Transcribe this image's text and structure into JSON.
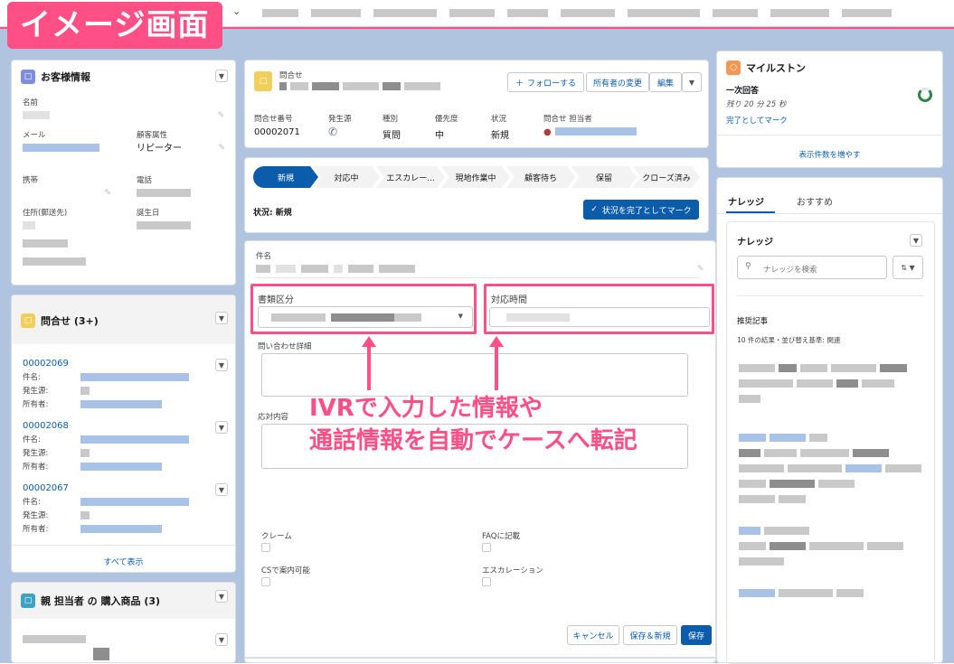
{
  "badge": "イメージ画面",
  "customer": {
    "title": "お客様情報",
    "fields": {
      "name": "名前",
      "email": "メール",
      "attribute": "顧客属性",
      "attribute_value": "リピーター",
      "mobile": "携帯",
      "phone": "電話",
      "address": "住所(郵送先)",
      "birthday": "誕生日"
    }
  },
  "inquiries": {
    "title": "問合せ (3+)",
    "items": [
      {
        "number": "00002069",
        "l1": "件名:",
        "l2": "発生源:",
        "l3": "所有者:"
      },
      {
        "number": "00002068",
        "l1": "件名:",
        "l2": "発生源:",
        "l3": "所有者:"
      },
      {
        "number": "00002067",
        "l1": "件名:",
        "l2": "発生源:",
        "l3": "所有者:"
      }
    ],
    "view_all": "すべて表示"
  },
  "purchases": {
    "title": "親 担当者 の 購入商品 (3)"
  },
  "case_header": {
    "object_label": "問合せ",
    "follow": "フォローする",
    "change_owner": "所有者の変更",
    "edit": "編集",
    "fields": [
      {
        "label": "問合せ番号",
        "value": "00002071"
      },
      {
        "label": "発生源",
        "value": ""
      },
      {
        "label": "種別",
        "value": "質問"
      },
      {
        "label": "優先度",
        "value": "中"
      },
      {
        "label": "状況",
        "value": "新規"
      },
      {
        "label": "問合せ 担当者",
        "value": ""
      }
    ]
  },
  "path": {
    "steps": [
      "新規",
      "対応中",
      "エスカレー...",
      "現地作業中",
      "顧客待ち",
      "保留",
      "クローズ済み"
    ],
    "status_text": "状況: 新規",
    "complete_button": "状況を完了としてマーク"
  },
  "form": {
    "subject_label": "件名",
    "category_label": "書類区分",
    "time_label": "対応時間",
    "detail_label": "問い合わせ詳細",
    "response_label": "応対内容",
    "claim_label": "クレーム",
    "faq_label": "FAQに記載",
    "cs_label": "CSで案内可能",
    "escalation_label": "エスカレーション",
    "cancel": "キャンセル",
    "save_new": "保存＆新規",
    "save": "保存"
  },
  "annotation": {
    "line1": "IVRで入力した情報や",
    "line2": "通話情報を自動でケースへ転記"
  },
  "milestone": {
    "title": "マイルストン",
    "name": "一次回答",
    "remaining": "残り 20 分 25 秒",
    "mark_complete": "完了としてマーク",
    "show_more": "表示件数を増やす"
  },
  "knowledge": {
    "tab_knowledge": "ナレッジ",
    "tab_recommend": "おすすめ",
    "title": "ナレッジ",
    "search_placeholder": "ナレッジを検索",
    "recommended": "推奨記事",
    "results": "10 件の結果・並び替え基準: 関連"
  },
  "colors": {
    "accent": "#ff4f87",
    "brand": "#0b5cab",
    "background": "#b0c4df"
  }
}
